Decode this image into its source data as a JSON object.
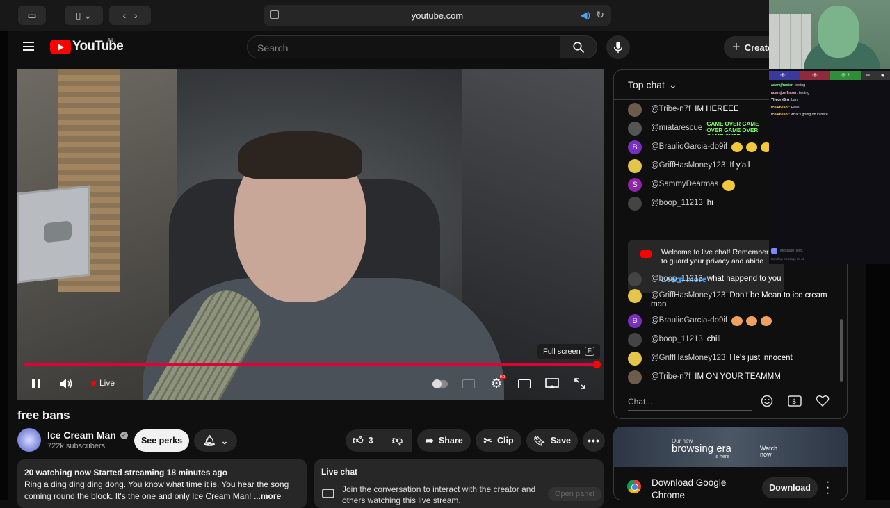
{
  "browser": {
    "url": "youtube.com"
  },
  "header": {
    "logo_text": "YouTube",
    "country": "AU",
    "search_placeholder": "Search",
    "create_label": "Create"
  },
  "player": {
    "fullscreen_tip": "Full screen",
    "fullscreen_key": "F",
    "live_label": "Live",
    "progress": 1.0,
    "accent": "#e00036"
  },
  "video": {
    "title": "free bans",
    "channel": "Ice Cream Man",
    "subscribers": "722k subscribers",
    "see_perks": "See perks",
    "likes": "3",
    "share": "Share",
    "clip": "Clip",
    "save": "Save"
  },
  "description": {
    "meta": "20 watching now  Started streaming 18 minutes ago",
    "text": "Ring a ding ding ding dong. You know what time it is. You hear the song coming round the block. It's the one and only Ice Cream Man!",
    "more": "...more"
  },
  "live_chat_panel": {
    "label": "Live chat",
    "text": "Join the conversation to interact with the creator and others watching this live stream.",
    "button": "Open panel"
  },
  "chat": {
    "header": "Top chat",
    "messages": [
      {
        "author": "@Tribe-n7f",
        "text": "IM HEREEE",
        "avatar": "",
        "color": "#6d5b4c"
      },
      {
        "author": "@miatarescue",
        "text": "GAME OVER GAME OVER GAME OVER GAME OVER",
        "avatar": "",
        "color": "#555"
      },
      {
        "author": "@BraulioGarcia-do9if",
        "text": "",
        "avatar": "B",
        "color": "#7b2fbe"
      },
      {
        "author": "@GriffHasMoney123",
        "text": "If y'all",
        "avatar": "",
        "color": "#e4c54a"
      },
      {
        "author": "@SammyDearmas",
        "text": "",
        "avatar": "S",
        "color": "#8e24aa"
      },
      {
        "author": "@boop_11213",
        "text": "hi",
        "avatar": "",
        "color": "#444"
      },
      {
        "author": "@boop_11213",
        "text": "what happend to you",
        "avatar": "",
        "color": "#444"
      },
      {
        "author": "@GriffHasMoney123",
        "text": "Don't be Mean to ice cream man",
        "avatar": "",
        "color": "#e4c54a"
      },
      {
        "author": "@BraulioGarcia-do9if",
        "text": "",
        "avatar": "B",
        "color": "#7b2fbe"
      },
      {
        "author": "@boop_11213",
        "text": "chill",
        "avatar": "",
        "color": "#444"
      },
      {
        "author": "@GriffHasMoney123",
        "text": "He's just innocent",
        "avatar": "",
        "color": "#e4c54a"
      },
      {
        "author": "@Tribe-n7f",
        "text": "IM ON YOUR TEAMMM",
        "avatar": "",
        "color": "#6d5b4c"
      }
    ],
    "welcome": "Welcome to live chat! Remember to guard your privacy and abide by our Community Guidelines.",
    "learn_more": "Learn more",
    "input_placeholder": "Chat..."
  },
  "ad": {
    "banner_small": "Our new",
    "banner_main": "browsing era",
    "banner_sub": "is here",
    "banner_watch": "Watch now",
    "title": "Download Google Chrome",
    "button": "Download"
  },
  "overlay": {
    "tabs": [
      "1",
      "",
      "2"
    ],
    "lines": [
      {
        "user": "adamjfrasier",
        "text": "testing"
      },
      {
        "user": "adamjoelfraser",
        "text": "testing"
      },
      {
        "user": "TheoryBro",
        "text": "bars"
      },
      {
        "user": "iceadvisor",
        "text": "Hello"
      },
      {
        "user": "iceadvisor",
        "text": "what's going on in here"
      }
    ],
    "input_placeholder": "Message Text...",
    "footer": "Sending message to: All"
  }
}
